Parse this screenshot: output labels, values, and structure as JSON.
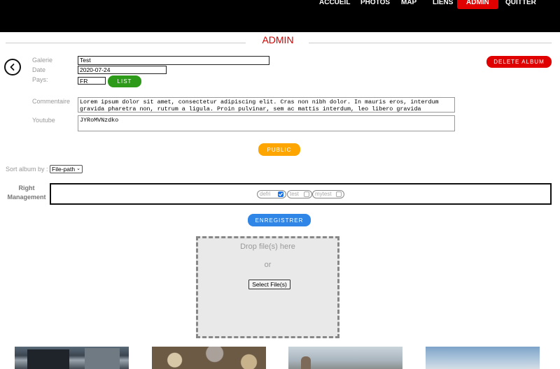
{
  "nav": {
    "items": [
      {
        "label": "ACCUEIL"
      },
      {
        "label": "PHOTOS"
      },
      {
        "label": "MAP"
      },
      {
        "label": "LIENS"
      },
      {
        "label": "ADMIN"
      },
      {
        "label": "QUITTER"
      }
    ],
    "active_color": "#e00000"
  },
  "page": {
    "title": "ADMIN"
  },
  "form": {
    "galerie_label": "Galerie",
    "galerie_value": "Test",
    "date_label": "Date",
    "date_value": "2020-07-24",
    "pays_label": "Pays:",
    "pays_value": "FR",
    "list_button": "LIST",
    "commentaire_label": "Commentaire",
    "commentaire_value": "Lorem ipsum dolor sit amet, consectetur adipiscing elit. Cras non nibh dolor. In mauris eros, interdum gravida pharetra non, rutrum a ligula. Proin pulvinar, sem ac mattis interdum, leo libero gravida",
    "youtube_label": "Youtube",
    "youtube_value": "JYRoMVNzdko",
    "delete_button": "DELETE ALBUM",
    "public_button": "PUBLIC"
  },
  "sort": {
    "label": "Sort album by :",
    "selected": "File-path"
  },
  "rights": {
    "label": "Right Management",
    "tags": [
      {
        "label": "defri",
        "checked": true
      },
      {
        "label": "test",
        "checked": false
      },
      {
        "label": "mytest",
        "checked": false
      }
    ],
    "save_button": "ENREGISTRER"
  },
  "upload": {
    "drop_text": "Drop file(s) here",
    "or_text": "or",
    "select_button": "Select File(s)"
  },
  "colors": {
    "accent_red": "#e00000",
    "list_green": "#2e9a1a",
    "public_orange": "#ffa500",
    "save_blue": "#2f86e6"
  }
}
